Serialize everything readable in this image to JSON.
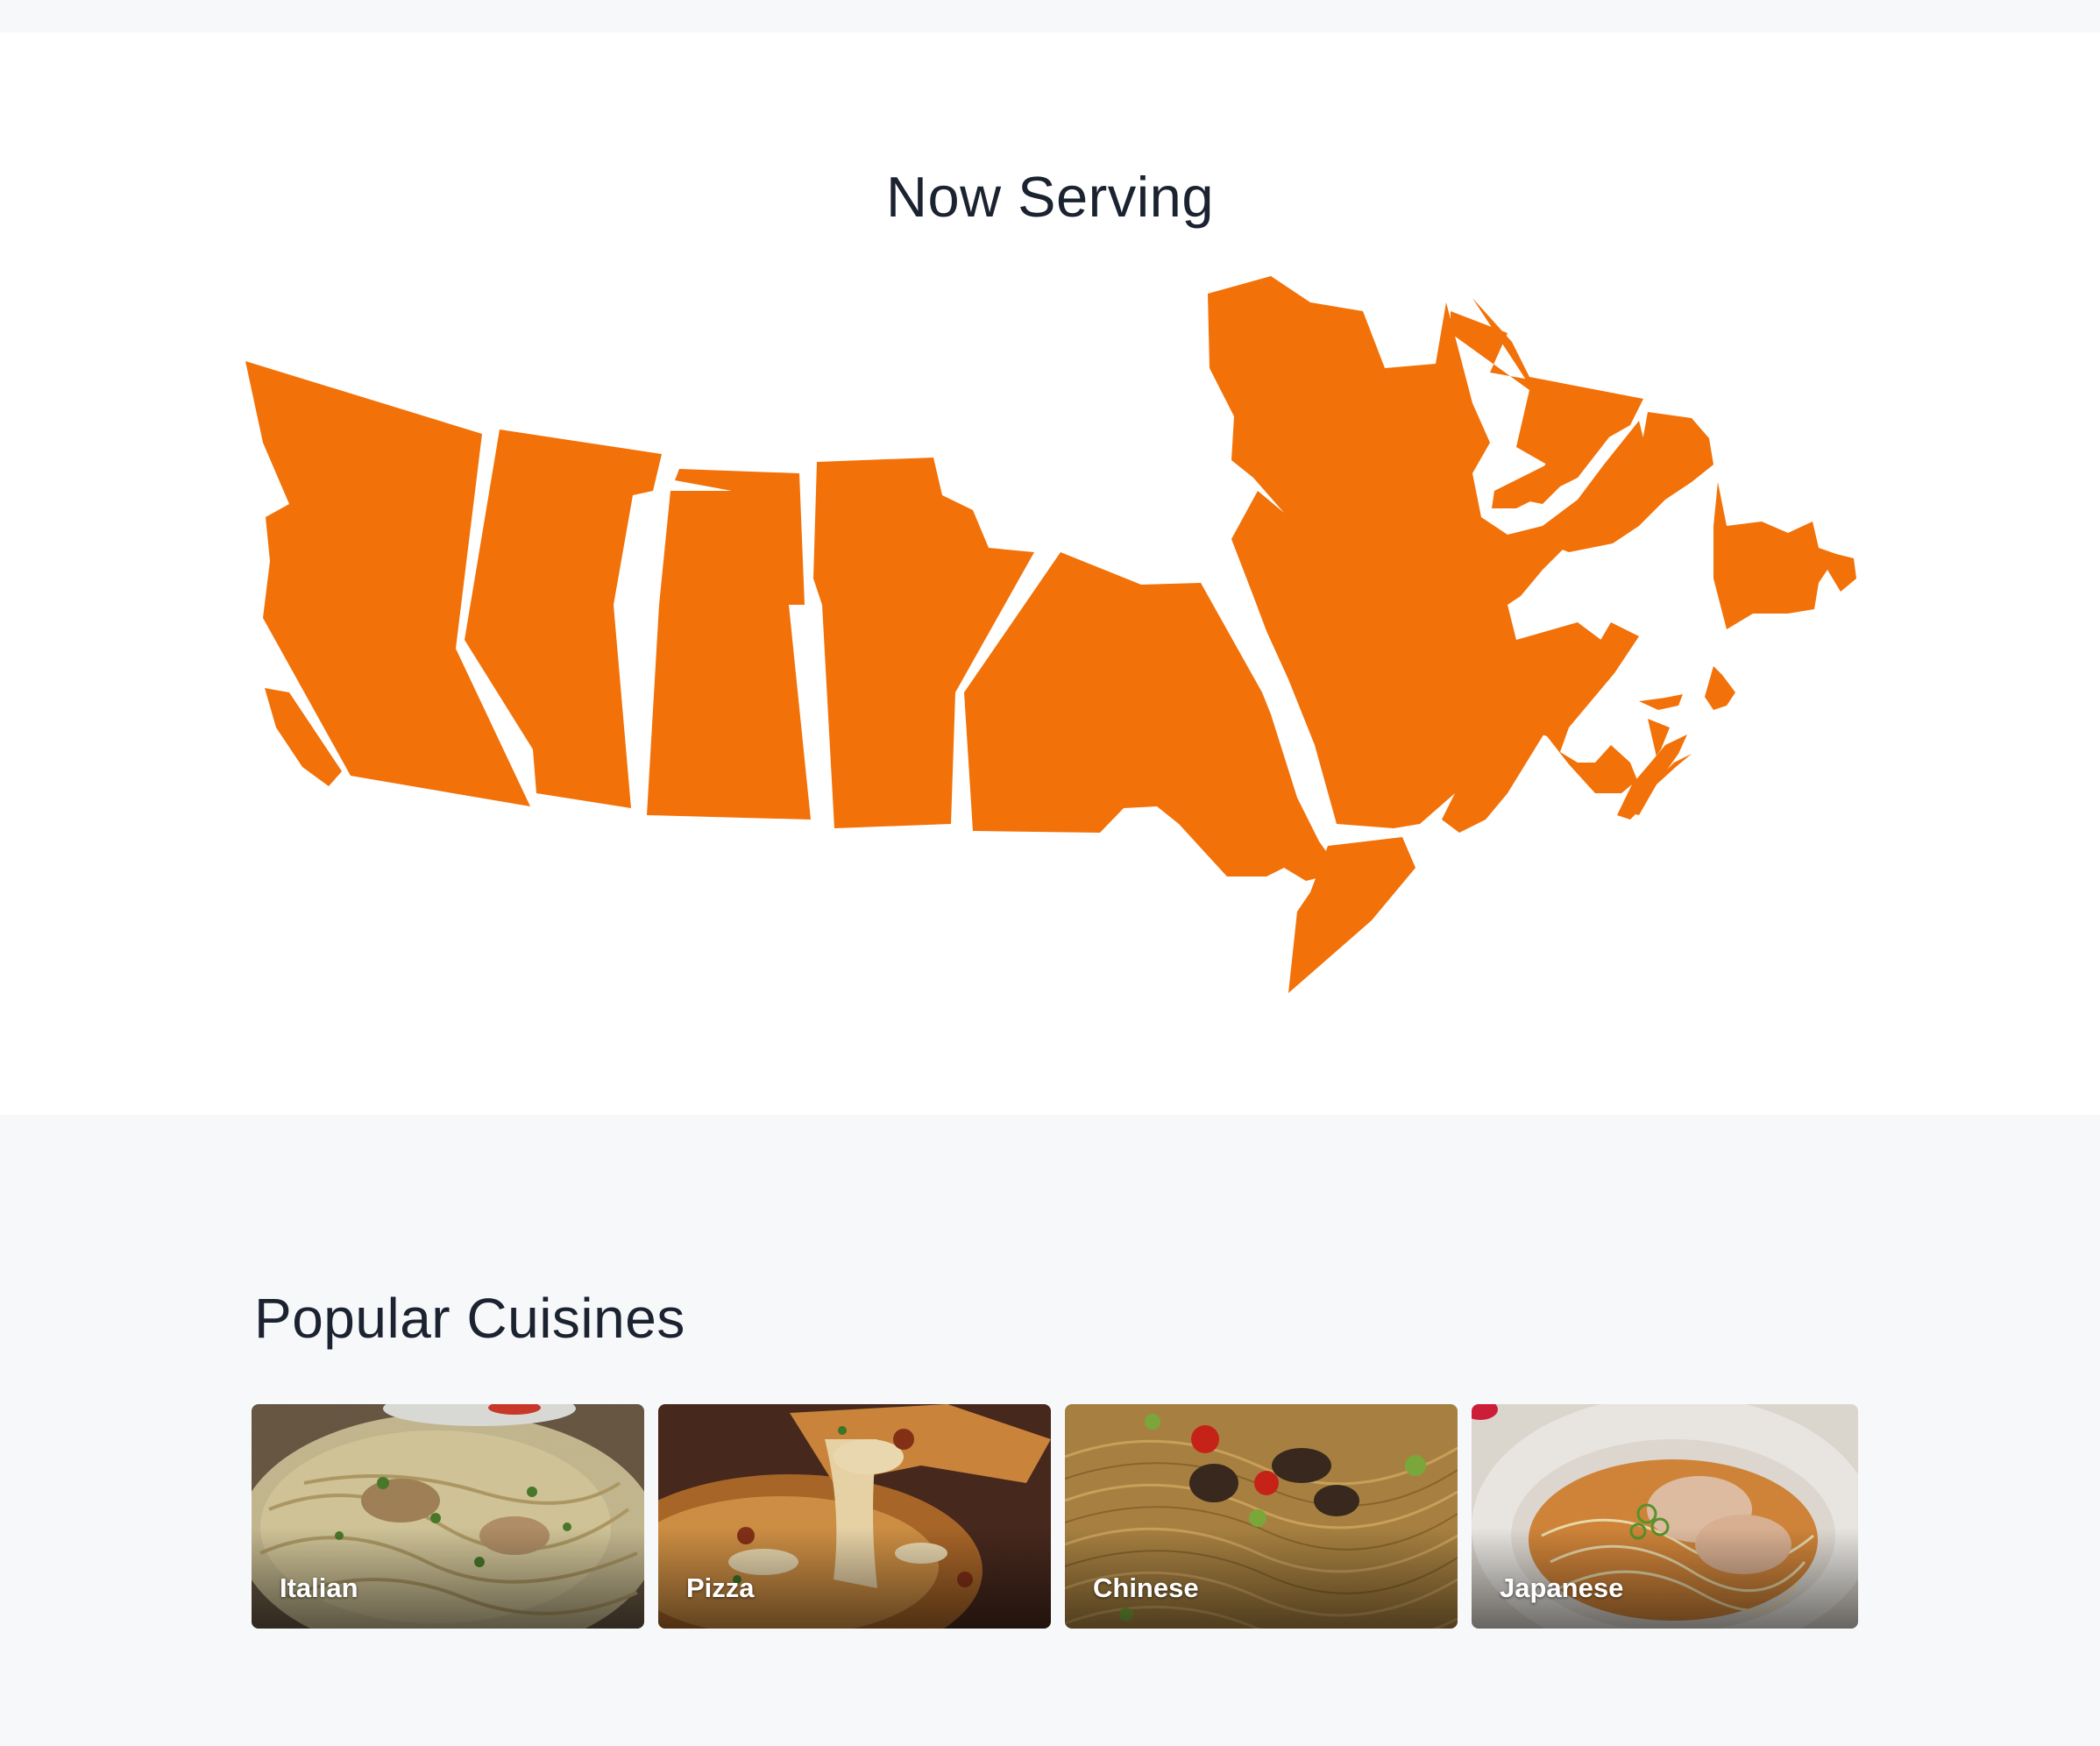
{
  "serving": {
    "title": "Now Serving",
    "map_color": "#f27108",
    "map_icon": "canada-provinces-map"
  },
  "cuisines": {
    "title": "Popular Cuisines",
    "items": [
      {
        "label": "Italian",
        "photo": "fettuccine-chicken-pasta"
      },
      {
        "label": "Pizza",
        "photo": "cheesy-pizza-slice"
      },
      {
        "label": "Chinese",
        "photo": "stir-fried-noodles"
      },
      {
        "label": "Japanese",
        "photo": "ramen-bowl"
      }
    ]
  }
}
